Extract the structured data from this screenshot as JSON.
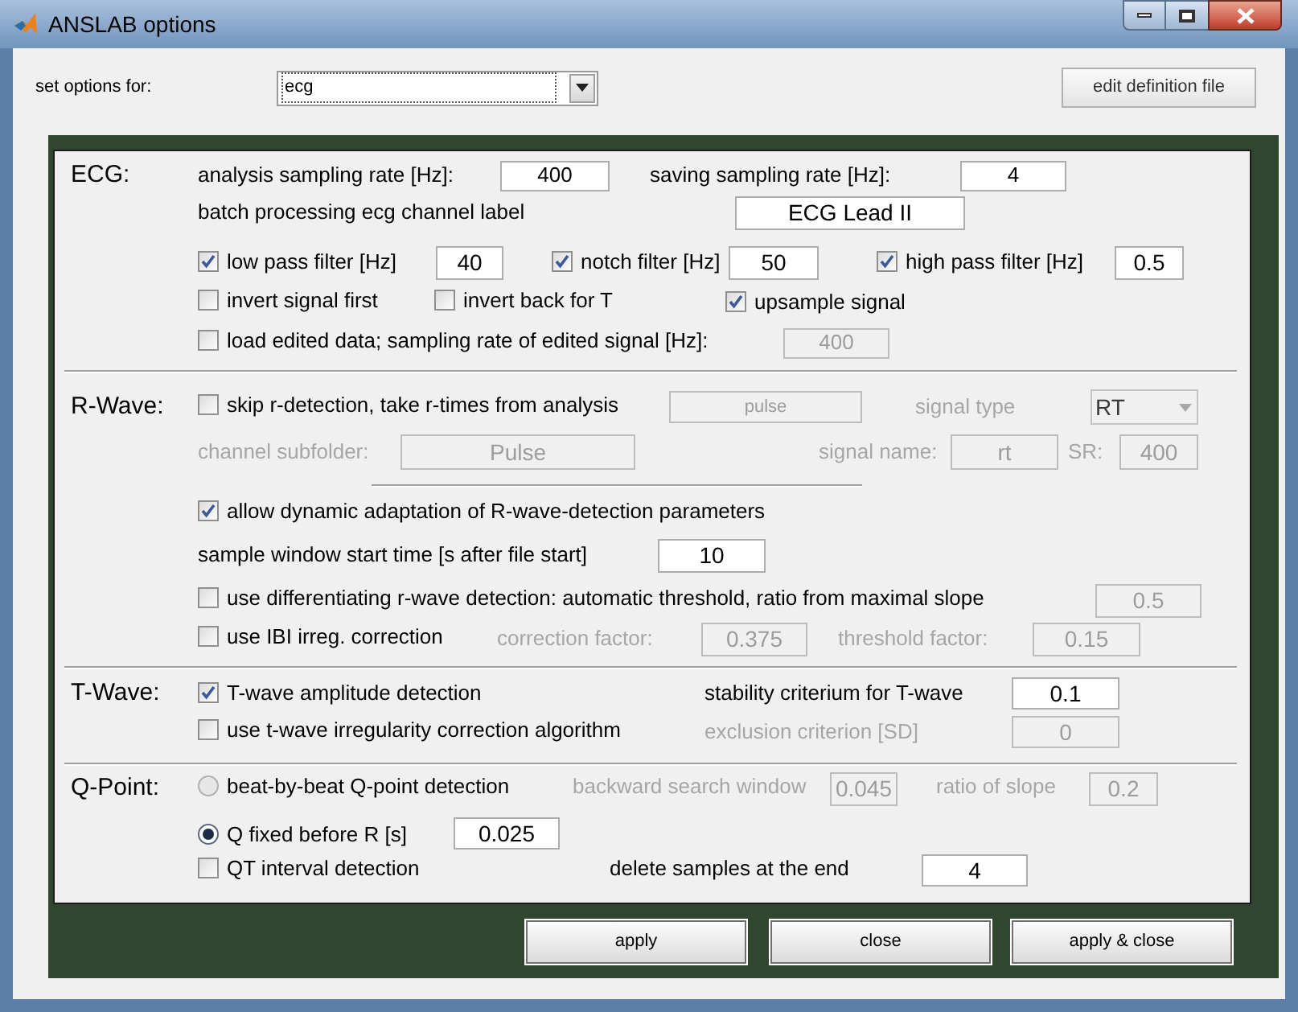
{
  "window": {
    "title": "ANSLAB options"
  },
  "header": {
    "label": "set options for:",
    "selector": {
      "value": "ecg"
    },
    "edit_button": "edit definition file"
  },
  "ecg": {
    "heading": "ECG:",
    "analysis_rate_label": {
      "text": "analysis sampling rate [Hz]:",
      "disabled": false
    },
    "analysis_rate": {
      "value": "400",
      "disabled": false
    },
    "saving_rate_label": {
      "text": "saving sampling rate [Hz]:",
      "disabled": false
    },
    "saving_rate": {
      "value": "4",
      "disabled": false
    },
    "channel_label_label": {
      "text": "batch processing ecg channel label",
      "disabled": false
    },
    "channel_label": {
      "value": "ECG Lead II",
      "disabled": false
    },
    "low_pass": {
      "label": "low pass filter [Hz]",
      "checked": true
    },
    "low_pass_value": {
      "value": "40",
      "disabled": false
    },
    "notch": {
      "label": "notch filter [Hz]",
      "checked": true
    },
    "notch_value": {
      "value": "50",
      "disabled": false
    },
    "high_pass": {
      "label": "high pass filter [Hz]",
      "checked": true
    },
    "high_pass_value": {
      "value": "0.5",
      "disabled": false
    },
    "invert_first": {
      "label": "invert signal first",
      "checked": false
    },
    "invert_back": {
      "label": "invert back for T",
      "checked": false
    },
    "upsample": {
      "label": "upsample signal",
      "checked": true
    },
    "load_edited": {
      "label": "load edited data; sampling rate of edited signal [Hz]:",
      "checked": false
    },
    "edited_rate": {
      "value": "400",
      "disabled": true
    }
  },
  "r_wave": {
    "heading": "R-Wave:",
    "skip": {
      "label": "skip r-detection, take r-times from analysis",
      "checked": false
    },
    "source": {
      "value": "pulse",
      "disabled": true
    },
    "signal_type_label": {
      "text": "signal type",
      "disabled": true
    },
    "signal_type": {
      "value": "RT",
      "disabled": true
    },
    "subfolder_label": {
      "text": "channel subfolder:",
      "disabled": true
    },
    "subfolder": {
      "value": "Pulse",
      "disabled": true
    },
    "signal_name_label": {
      "text": "signal name:",
      "disabled": true
    },
    "signal_name": {
      "value": "rt",
      "disabled": true
    },
    "sr_label": {
      "text": "SR:",
      "disabled": true
    },
    "sr": {
      "value": "400",
      "disabled": true
    },
    "dynamic": {
      "label": "allow dynamic adaptation of R-wave-detection parameters",
      "checked": true
    },
    "window_start_label": {
      "text": "sample window start time [s after file start]",
      "disabled": false
    },
    "window_start": {
      "value": "10",
      "disabled": false
    },
    "differentiating": {
      "label": "use differentiating r-wave detection: automatic threshold, ratio from maximal slope",
      "checked": false
    },
    "slope_ratio": {
      "value": "0.5",
      "disabled": true
    },
    "ibi": {
      "label": "use IBI irreg. correction",
      "checked": false
    },
    "correction_label": {
      "text": "correction factor:",
      "disabled": true
    },
    "correction": {
      "value": "0.375",
      "disabled": true
    },
    "threshold_label": {
      "text": "threshold factor:",
      "disabled": true
    },
    "threshold": {
      "value": "0.15",
      "disabled": true
    }
  },
  "t_wave": {
    "heading": "T-Wave:",
    "amplitude": {
      "label": "T-wave amplitude detection",
      "checked": true
    },
    "stability_label": {
      "text": "stability criterium for T-wave",
      "disabled": false
    },
    "stability": {
      "value": "0.1",
      "disabled": false
    },
    "irregularity": {
      "label": "use t-wave irregularity correction algorithm",
      "checked": false
    },
    "exclusion_label": {
      "text": "exclusion criterion [SD]",
      "disabled": true
    },
    "exclusion": {
      "value": "0",
      "disabled": true
    }
  },
  "q_point": {
    "heading": "Q-Point:",
    "modes": [
      {
        "label": "beat-by-beat Q-point detection",
        "selected": false
      },
      {
        "label": "Q fixed before R [s]",
        "selected": true
      }
    ],
    "backward_label": {
      "text": "backward search  window",
      "disabled": true
    },
    "backward": {
      "value": "0.045",
      "disabled": true
    },
    "ratio_label": {
      "text": "ratio of slope",
      "disabled": true
    },
    "ratio": {
      "value": "0.2",
      "disabled": true
    },
    "q_fixed": {
      "value": "0.025",
      "disabled": false
    },
    "qt": {
      "label": "QT interval detection",
      "checked": false
    },
    "delete_label": {
      "text": "delete samples at the end",
      "disabled": false
    },
    "delete": {
      "value": "4",
      "disabled": false
    }
  },
  "buttons": [
    "apply",
    "close",
    "apply & close"
  ]
}
